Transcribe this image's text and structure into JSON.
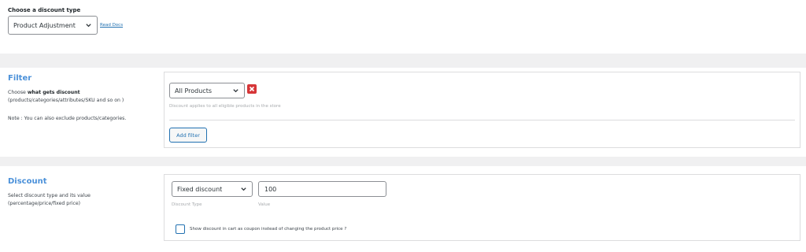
{
  "discount_type": {
    "label": "Choose a discount type",
    "selected": "Product Adjustment",
    "read_docs": "Read Docs"
  },
  "filter": {
    "title": "Filter",
    "desc_prefix": "Choose ",
    "desc_bold": "what gets discount",
    "desc_line2": "(products/categories/attributes/SKU and so on )",
    "note": "Note : You can also exclude products/categories.",
    "selected": "All Products",
    "hint": "Discount applies to all eligible products in the store",
    "add_filter": "Add filter"
  },
  "discount": {
    "title": "Discount",
    "desc_line1": "Select discount type and its value",
    "desc_line2": "(percentage/price/fixed price)",
    "type_selected": "Fixed discount",
    "value": "100",
    "type_label": "Discount Type",
    "value_label": "Value",
    "checkbox_label": "Show discount in cart as coupon instead of changing the product price ?",
    "checkbox_checked": false
  },
  "colors": {
    "accent": "#2271b1",
    "title": "#4a90d9",
    "danger": "#d63638",
    "band": "#f0f0f1"
  }
}
